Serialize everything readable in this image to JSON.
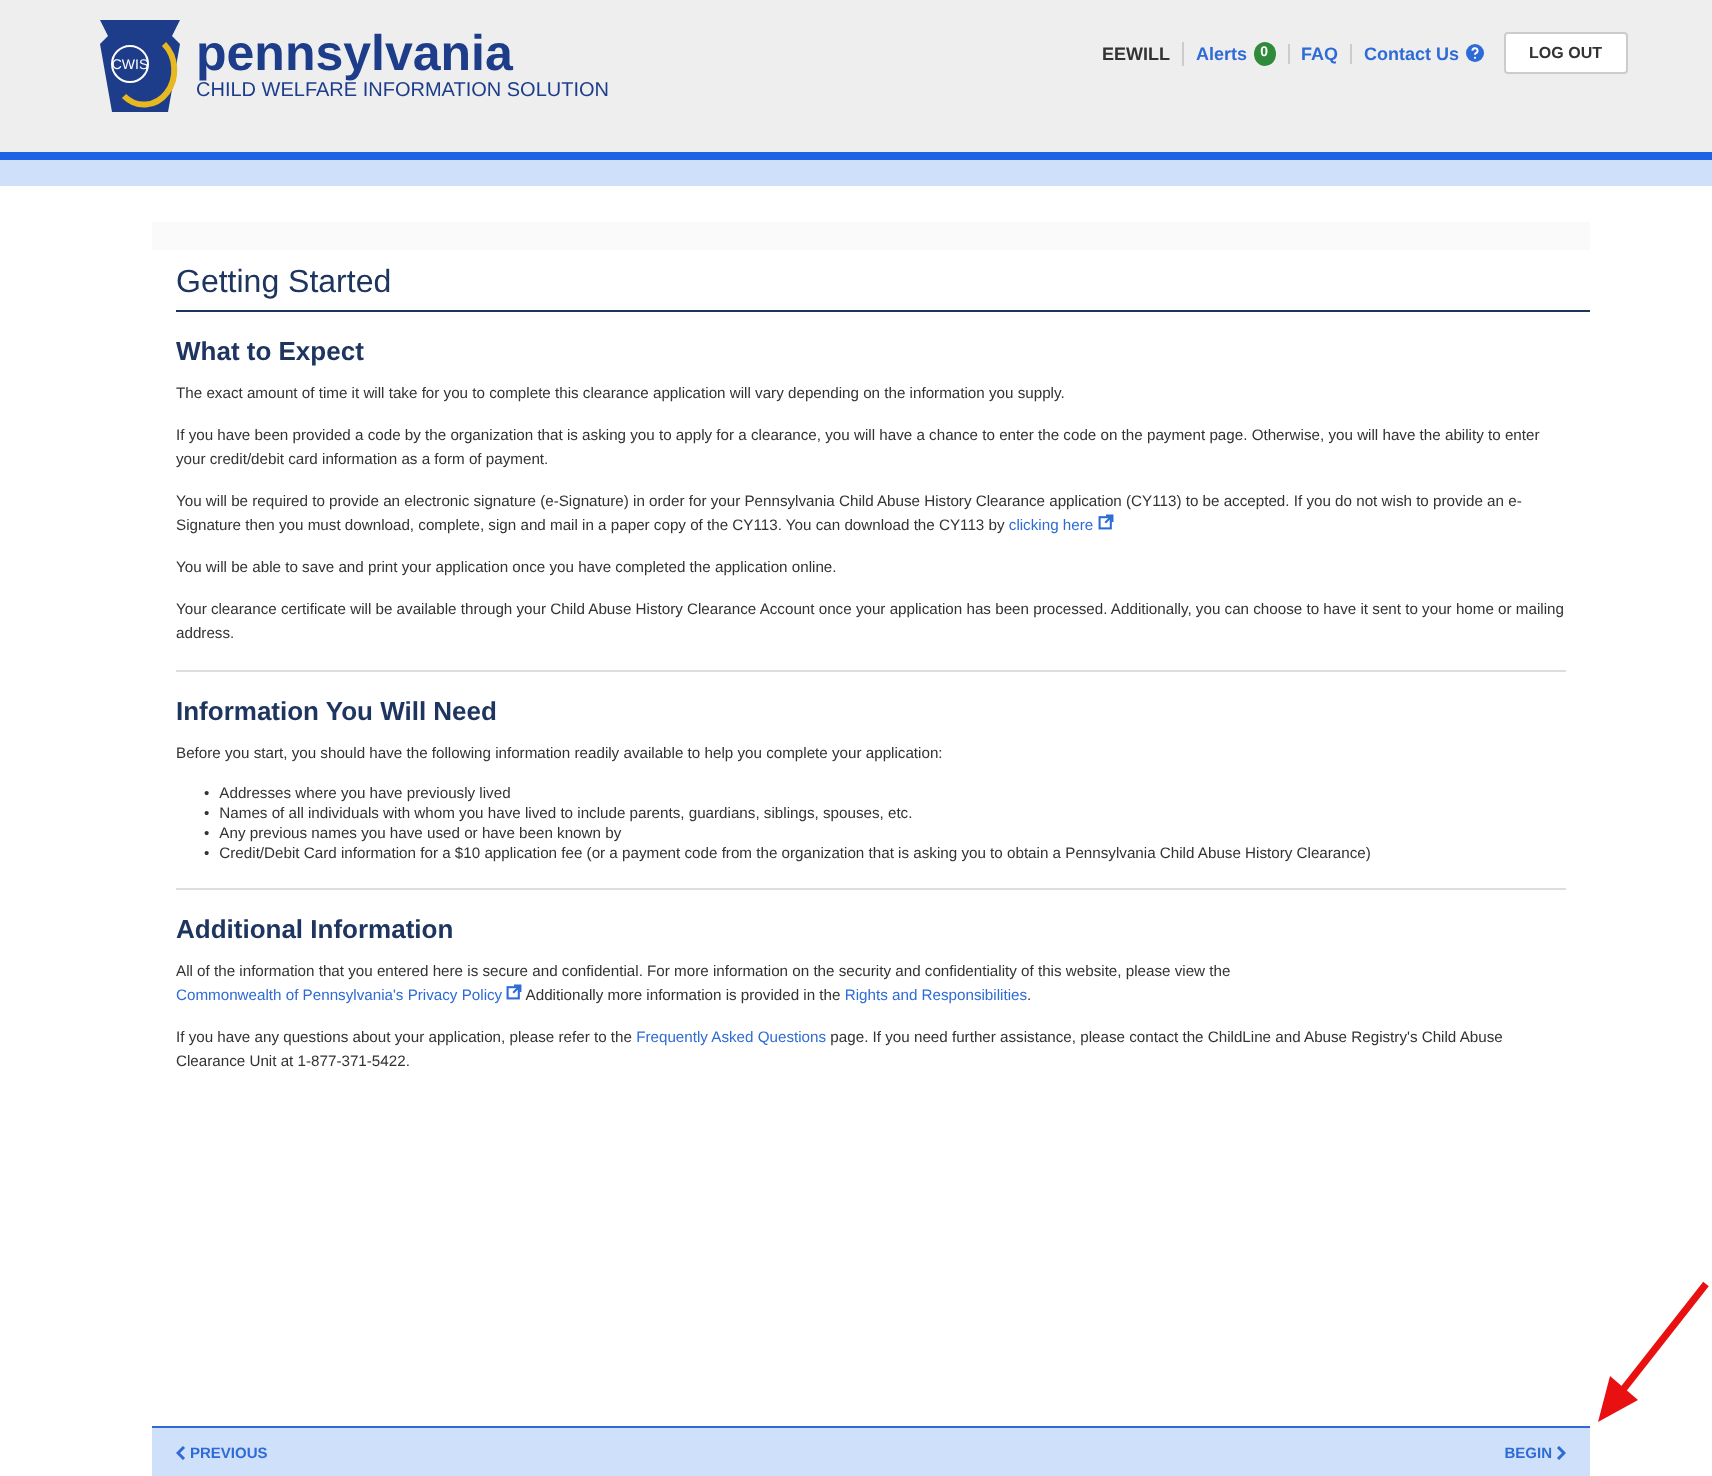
{
  "header": {
    "logo": {
      "badge": "CWIS",
      "title": "pennsylvania",
      "subtitle": "CHILD WELFARE INFORMATION SOLUTION"
    },
    "user": "EEWILL",
    "nav": [
      {
        "kind": "badge",
        "label": "Alerts",
        "badge": "0"
      },
      {
        "kind": "plain",
        "label": "FAQ"
      },
      {
        "kind": "help",
        "label": "Contact Us"
      }
    ],
    "logout": "LOG OUT"
  },
  "page_title": "Getting Started",
  "sections": [
    {
      "heading": "What to Expect",
      "blocks": [
        {
          "kind": "paragraph",
          "parts": [
            {
              "kind": "text",
              "text": "The exact amount of time it will take for you to complete this clearance application will vary depending on the information you supply."
            }
          ]
        },
        {
          "kind": "paragraph",
          "parts": [
            {
              "kind": "text",
              "text": "If you have been provided a code by the organization that is asking you to apply for a clearance, you will have a chance to enter the code on the payment page. Otherwise, you will have the ability to enter your credit/debit card information as a form of payment."
            }
          ]
        },
        {
          "kind": "paragraph",
          "parts": [
            {
              "kind": "text",
              "text": "You will be required to provide an electronic signature (e-Signature) in order for your Pennsylvania Child Abuse History Clearance application (CY113) to be accepted. If you do not wish to provide an e-Signature then you must download, complete, sign and mail in a paper copy of the CY113. You can download the CY113 by "
            },
            {
              "kind": "external_link",
              "text": "clicking here"
            }
          ]
        },
        {
          "kind": "paragraph",
          "parts": [
            {
              "kind": "text",
              "text": "You will be able to save and print your application once you have completed the application online."
            }
          ]
        },
        {
          "kind": "paragraph",
          "parts": [
            {
              "kind": "text",
              "text": "Your clearance certificate will be available through your Child Abuse History Clearance Account once your application has been processed. Additionally, you can choose to have it sent to your home or mailing address."
            }
          ]
        }
      ]
    },
    {
      "heading": "Information You Will Need",
      "blocks": [
        {
          "kind": "paragraph",
          "parts": [
            {
              "kind": "text",
              "text": "Before you start, you should have the following information readily available to help you complete your application:"
            }
          ]
        },
        {
          "kind": "list",
          "marker": "•",
          "items": [
            "Addresses where you have previously lived",
            "Names of all individuals with whom you have lived to include parents, guardians, siblings, spouses, etc.",
            "Any previous names you have used or have been known by",
            "Credit/Debit Card information for a $10 application fee (or a payment code from the organization that is asking you to obtain a Pennsylvania Child Abuse History Clearance)"
          ]
        }
      ]
    },
    {
      "heading": "Additional Information",
      "blocks": [
        {
          "kind": "paragraph",
          "parts": [
            {
              "kind": "text",
              "text": "All of the information that you entered here is secure and confidential. For more information on the security and confidentiality of this website, please view the "
            },
            {
              "kind": "external_link",
              "text": "Commonwealth of Pennsylvania's Privacy Policy"
            },
            {
              "kind": "text",
              "text": " Additionally more information is provided in the "
            },
            {
              "kind": "link",
              "text": "Rights and Responsibilities"
            },
            {
              "kind": "text",
              "text": "."
            }
          ]
        },
        {
          "kind": "paragraph",
          "parts": [
            {
              "kind": "text",
              "text": "If you have any questions about your application, please refer to the "
            },
            {
              "kind": "link",
              "text": "Frequently Asked Questions"
            },
            {
              "kind": "text",
              "text": " page. If you need further assistance, please contact the ChildLine and Abuse Registry's Child Abuse Clearance Unit at 1-877-371-5422."
            }
          ]
        }
      ]
    }
  ],
  "footer": {
    "previous": "PREVIOUS",
    "next": "BEGIN"
  }
}
